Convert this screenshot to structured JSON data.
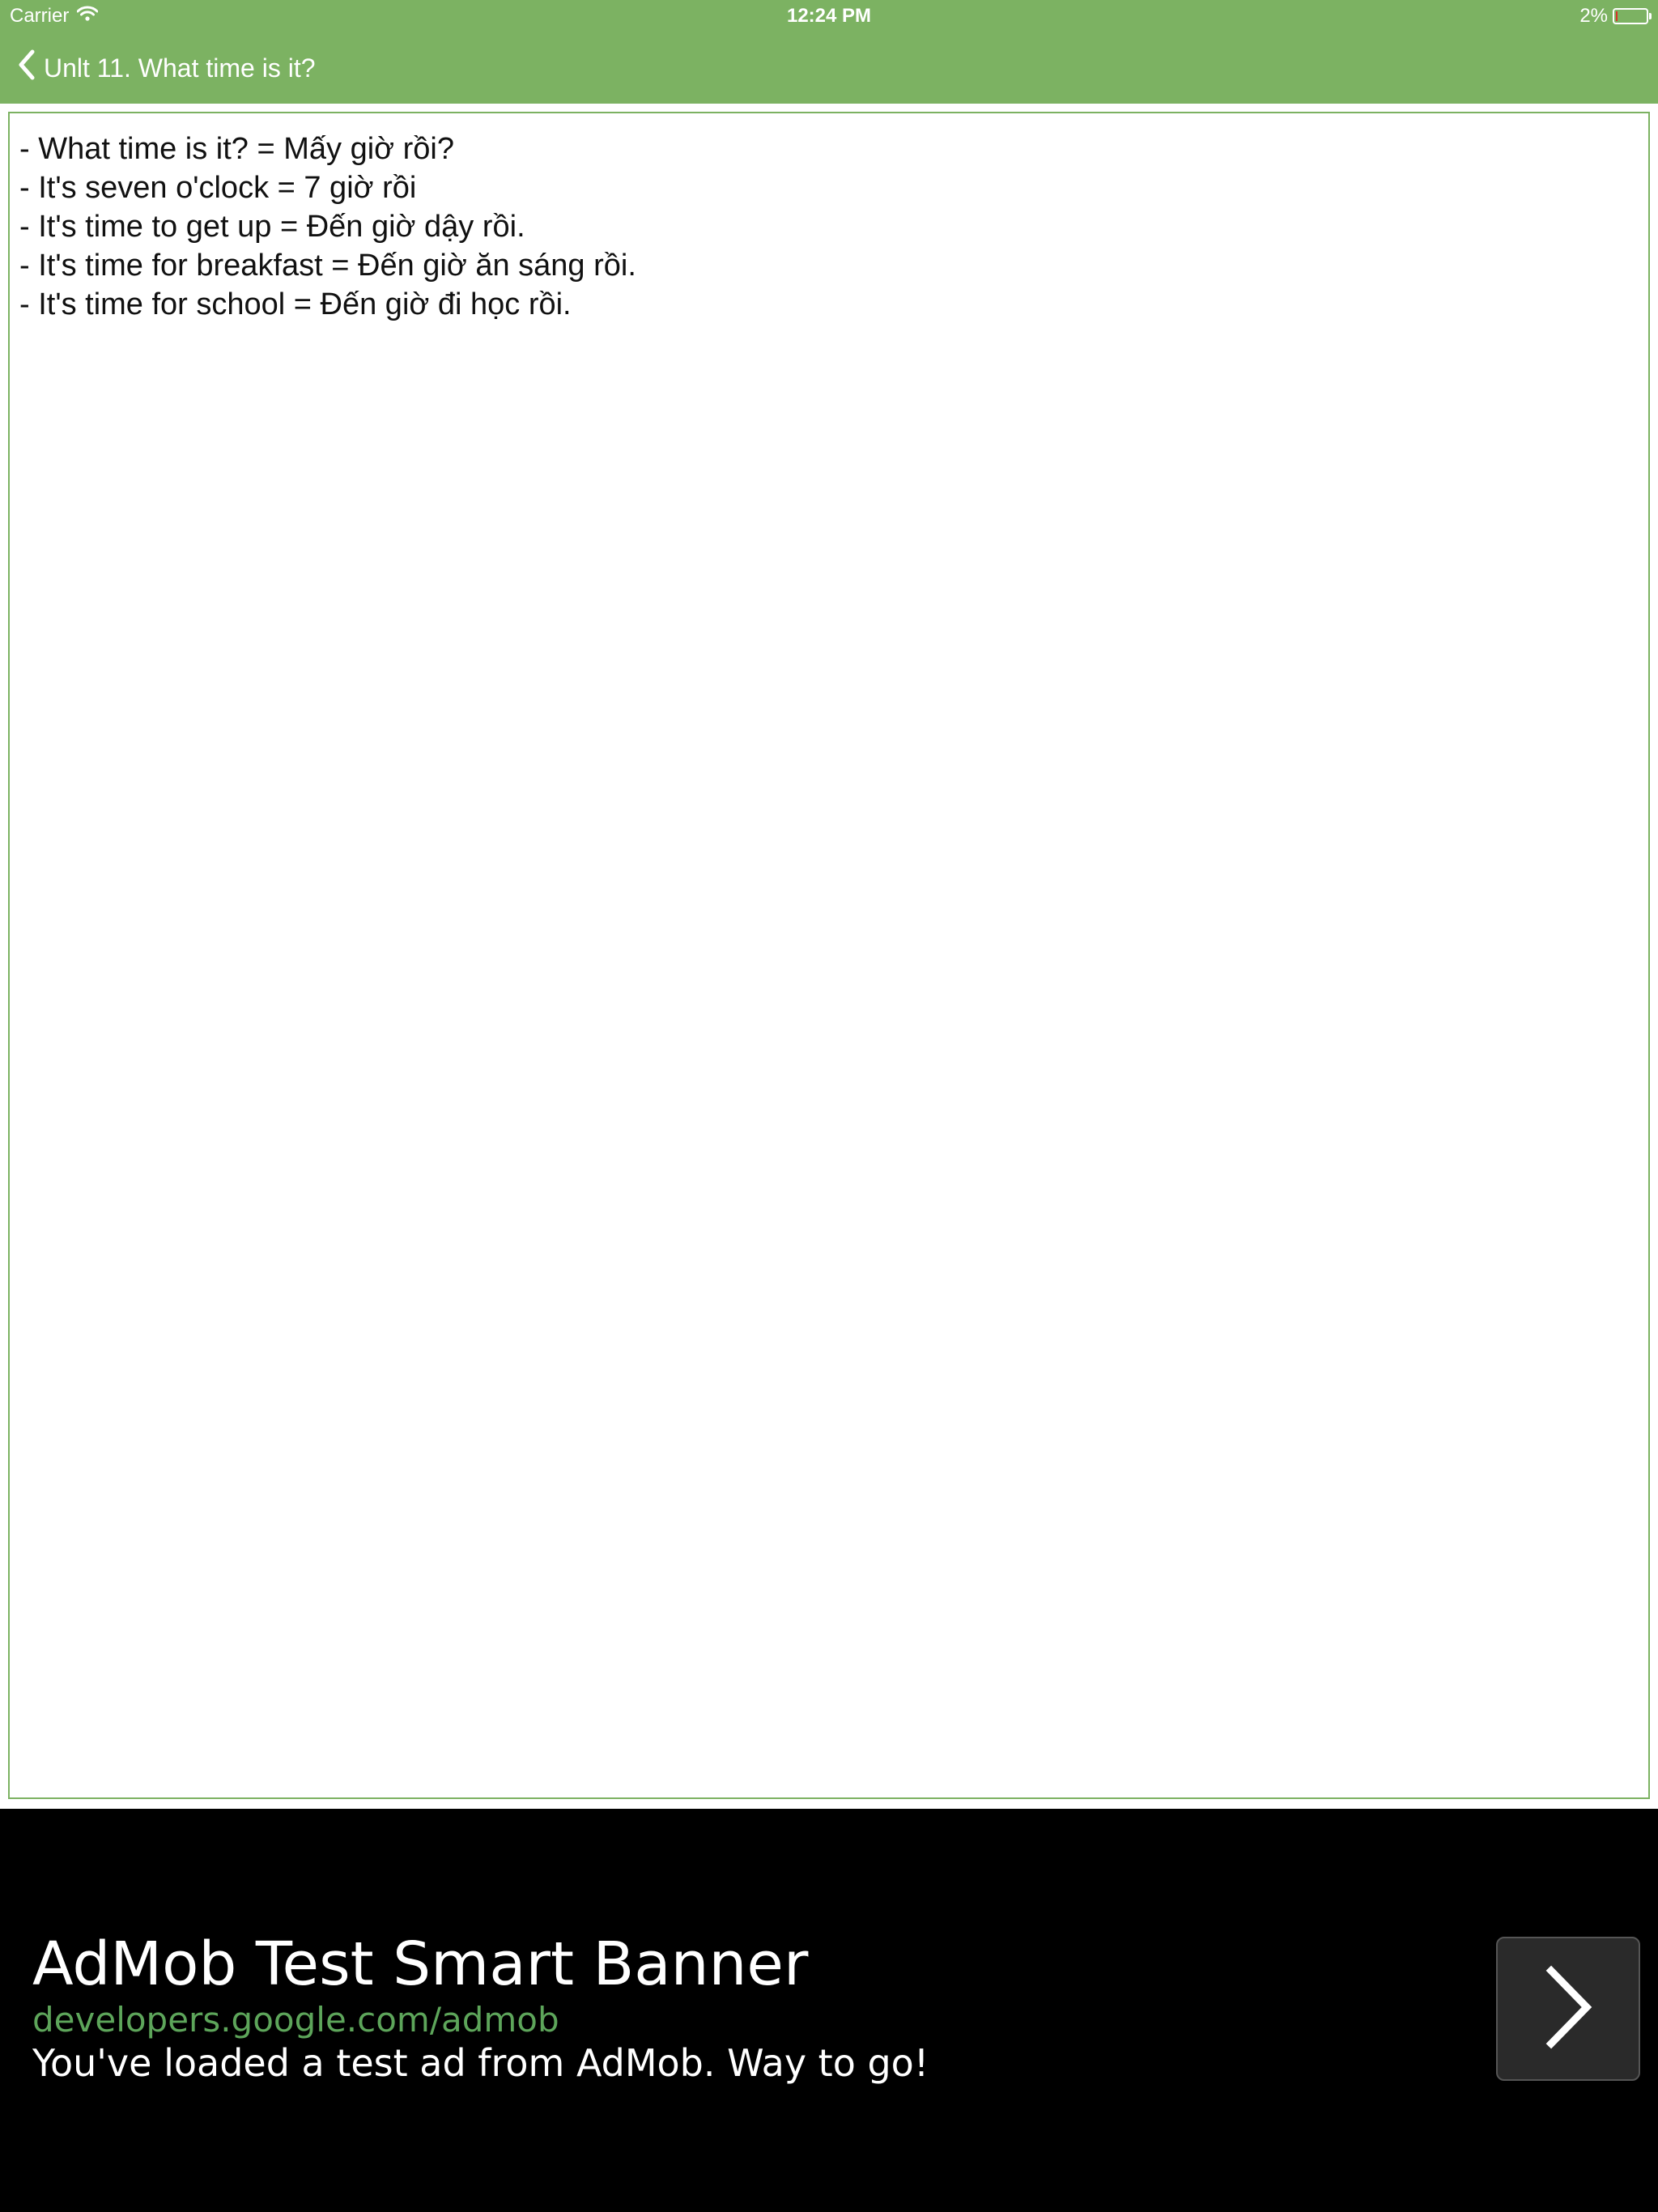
{
  "status_bar": {
    "carrier": "Carrier",
    "time": "12:24 PM",
    "battery_percent_label": "2%",
    "battery_level": 0.02,
    "icons": [
      "wifi-icon",
      "battery-icon"
    ]
  },
  "nav": {
    "back_icon": "chevron-left-icon",
    "title": "Unlt 11. What time is it?"
  },
  "lesson": {
    "lines": [
      "- What time is it? = Mấy giờ rồi?",
      "- It's seven o'clock = 7 giờ rồi",
      "- It's time to get up = Đến giờ dậy rồi.",
      "- It's time for breakfast = Đến giờ ăn sáng rồi.",
      "- It's time for school = Đến giờ đi học rồi."
    ]
  },
  "ad": {
    "headline": "AdMob Test Smart Banner",
    "url": "developers.google.com/admob",
    "description": "You've loaded a test ad from AdMob. Way to go!",
    "cta_icon": "chevron-right-icon"
  },
  "colors": {
    "header_green": "#7cb262",
    "ad_url_green": "#5da55a",
    "battery_low_red": "#d8342a"
  }
}
